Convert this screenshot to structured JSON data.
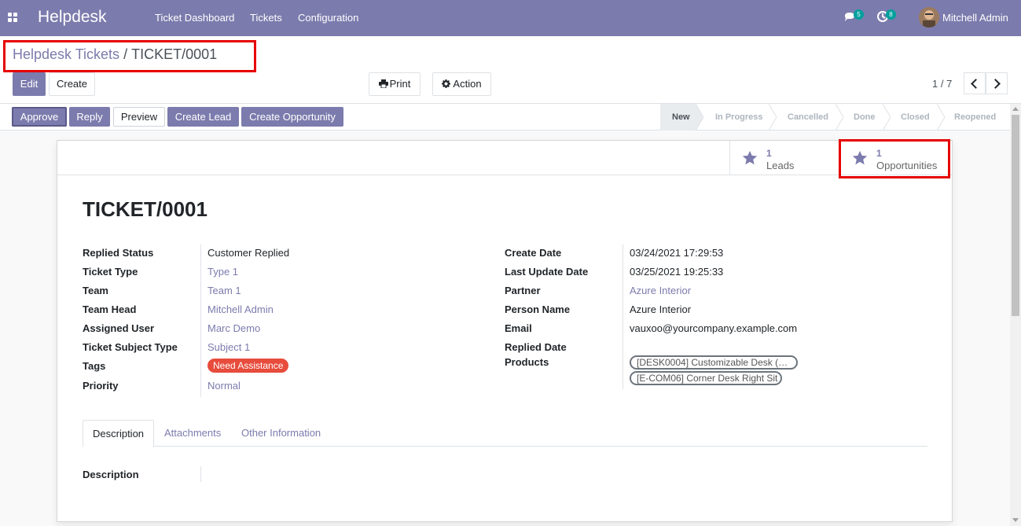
{
  "navbar": {
    "brand": "Helpdesk",
    "menu": [
      "Ticket Dashboard",
      "Tickets",
      "Configuration"
    ],
    "messages_count": "5",
    "activities_count": "8",
    "user_name": "Mitchell Admin",
    "color": "#7c7bad"
  },
  "breadcrumb": {
    "parent": "Helpdesk Tickets",
    "separator": "/",
    "current": "TICKET/0001"
  },
  "actions": {
    "edit": "Edit",
    "create": "Create",
    "print": "Print",
    "action": "Action"
  },
  "pager": {
    "value": "1 / 7"
  },
  "statusbar": {
    "buttons": [
      "Approve",
      "Reply",
      "Preview",
      "Create Lead",
      "Create Opportunity"
    ],
    "stages": [
      "New",
      "In Progress",
      "Cancelled",
      "Done",
      "Closed",
      "Reopened"
    ],
    "current_stage": "New"
  },
  "smart_buttons": {
    "leads": {
      "value": "1",
      "label": "Leads"
    },
    "opportunities": {
      "value": "1",
      "label": "Opportunities"
    }
  },
  "ticket": {
    "title": "TICKET/0001",
    "left": {
      "replied_status": {
        "label": "Replied Status",
        "value": "Customer Replied"
      },
      "ticket_type": {
        "label": "Ticket Type",
        "value": "Type 1"
      },
      "team": {
        "label": "Team",
        "value": "Team 1"
      },
      "team_head": {
        "label": "Team Head",
        "value": "Mitchell Admin"
      },
      "assigned_user": {
        "label": "Assigned User",
        "value": "Marc Demo"
      },
      "subject_type": {
        "label": "Ticket Subject Type",
        "value": "Subject 1"
      },
      "tags": {
        "label": "Tags",
        "value": "Need Assistance"
      },
      "priority": {
        "label": "Priority",
        "value": "Normal"
      }
    },
    "right": {
      "create_date": {
        "label": "Create Date",
        "value": "03/24/2021 17:29:53"
      },
      "last_update": {
        "label": "Last Update Date",
        "value": "03/25/2021 19:25:33"
      },
      "partner": {
        "label": "Partner",
        "value": "Azure Interior"
      },
      "person_name": {
        "label": "Person Name",
        "value": "Azure Interior"
      },
      "email": {
        "label": "Email",
        "value": "vauxoo@yourcompany.example.com"
      },
      "replied_date": {
        "label": "Replied Date",
        "value": ""
      },
      "products": {
        "label": "Products",
        "values": [
          "[DESK0004] Customizable Desk (…",
          "[E-COM06] Corner Desk Right Sit"
        ]
      }
    }
  },
  "tabs": [
    "Description",
    "Attachments",
    "Other Information"
  ],
  "description": {
    "label": "Description"
  }
}
